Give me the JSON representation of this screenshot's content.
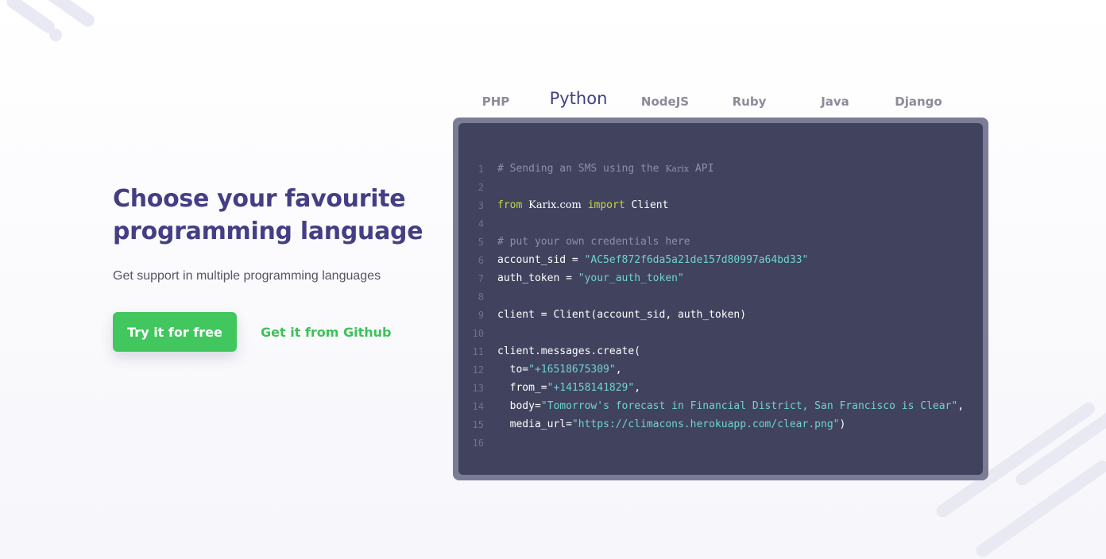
{
  "hero": {
    "title_line1": "Choose your favourite",
    "title_line2": "programming language",
    "subtitle": "Get support in multiple programming languages",
    "primary_button": "Try it for free",
    "secondary_link": "Get it from Github"
  },
  "tabs": {
    "items": [
      "PHP",
      "Python",
      "NodeJS",
      "Ruby",
      "Java",
      "Django"
    ],
    "active": "Python"
  },
  "code": {
    "lines": [
      {
        "n": "1",
        "tokens": [
          [
            "t-comment",
            "# Sending an SMS using the "
          ],
          [
            "t-brand-c",
            "Karix"
          ],
          [
            "t-comment",
            " API"
          ]
        ]
      },
      {
        "n": "2",
        "tokens": []
      },
      {
        "n": "3",
        "tokens": [
          [
            "t-kw",
            "from "
          ],
          [
            "t-brand",
            "Karix.com"
          ],
          [
            "t-kw",
            " import "
          ],
          [
            "t-plain",
            "Client"
          ]
        ]
      },
      {
        "n": "4",
        "tokens": []
      },
      {
        "n": "5",
        "tokens": [
          [
            "t-comment",
            "# put your own credentials here"
          ]
        ]
      },
      {
        "n": "6",
        "tokens": [
          [
            "t-plain",
            "account_sid = "
          ],
          [
            "t-str",
            "\"AC5ef872f6da5a21de157d80997a64bd33\""
          ]
        ]
      },
      {
        "n": "7",
        "tokens": [
          [
            "t-plain",
            "auth_token = "
          ],
          [
            "t-str",
            "\"your_auth_token\""
          ]
        ]
      },
      {
        "n": "8",
        "tokens": []
      },
      {
        "n": "9",
        "tokens": [
          [
            "t-plain",
            "client = Client(account_sid, auth_token)"
          ]
        ]
      },
      {
        "n": "10",
        "tokens": []
      },
      {
        "n": "11",
        "tokens": [
          [
            "t-plain",
            "client.messages.create("
          ]
        ]
      },
      {
        "n": "12",
        "tokens": [
          [
            "t-plain",
            "  to="
          ],
          [
            "t-str",
            "\"+16518675309\""
          ],
          [
            "t-plain",
            ","
          ]
        ]
      },
      {
        "n": "13",
        "tokens": [
          [
            "t-plain",
            "  from_="
          ],
          [
            "t-str",
            "\"+14158141829\""
          ],
          [
            "t-plain",
            ","
          ]
        ]
      },
      {
        "n": "14",
        "tokens": [
          [
            "t-plain",
            "  body="
          ],
          [
            "t-str",
            "\"Tomorrow's forecast in Financial District, San Francisco is Clear\""
          ],
          [
            "t-plain",
            ","
          ]
        ]
      },
      {
        "n": "15",
        "tokens": [
          [
            "t-plain",
            "  media_url="
          ],
          [
            "t-str",
            "\"https://climacons.herokuapp.com/clear.png\""
          ],
          [
            "t-plain",
            ")"
          ]
        ]
      },
      {
        "n": "16",
        "tokens": []
      }
    ]
  },
  "colors": {
    "accent_green": "#41c75e",
    "heading_purple": "#433f85",
    "code_bg": "#41425e",
    "code_frame": "#7b7c95"
  }
}
